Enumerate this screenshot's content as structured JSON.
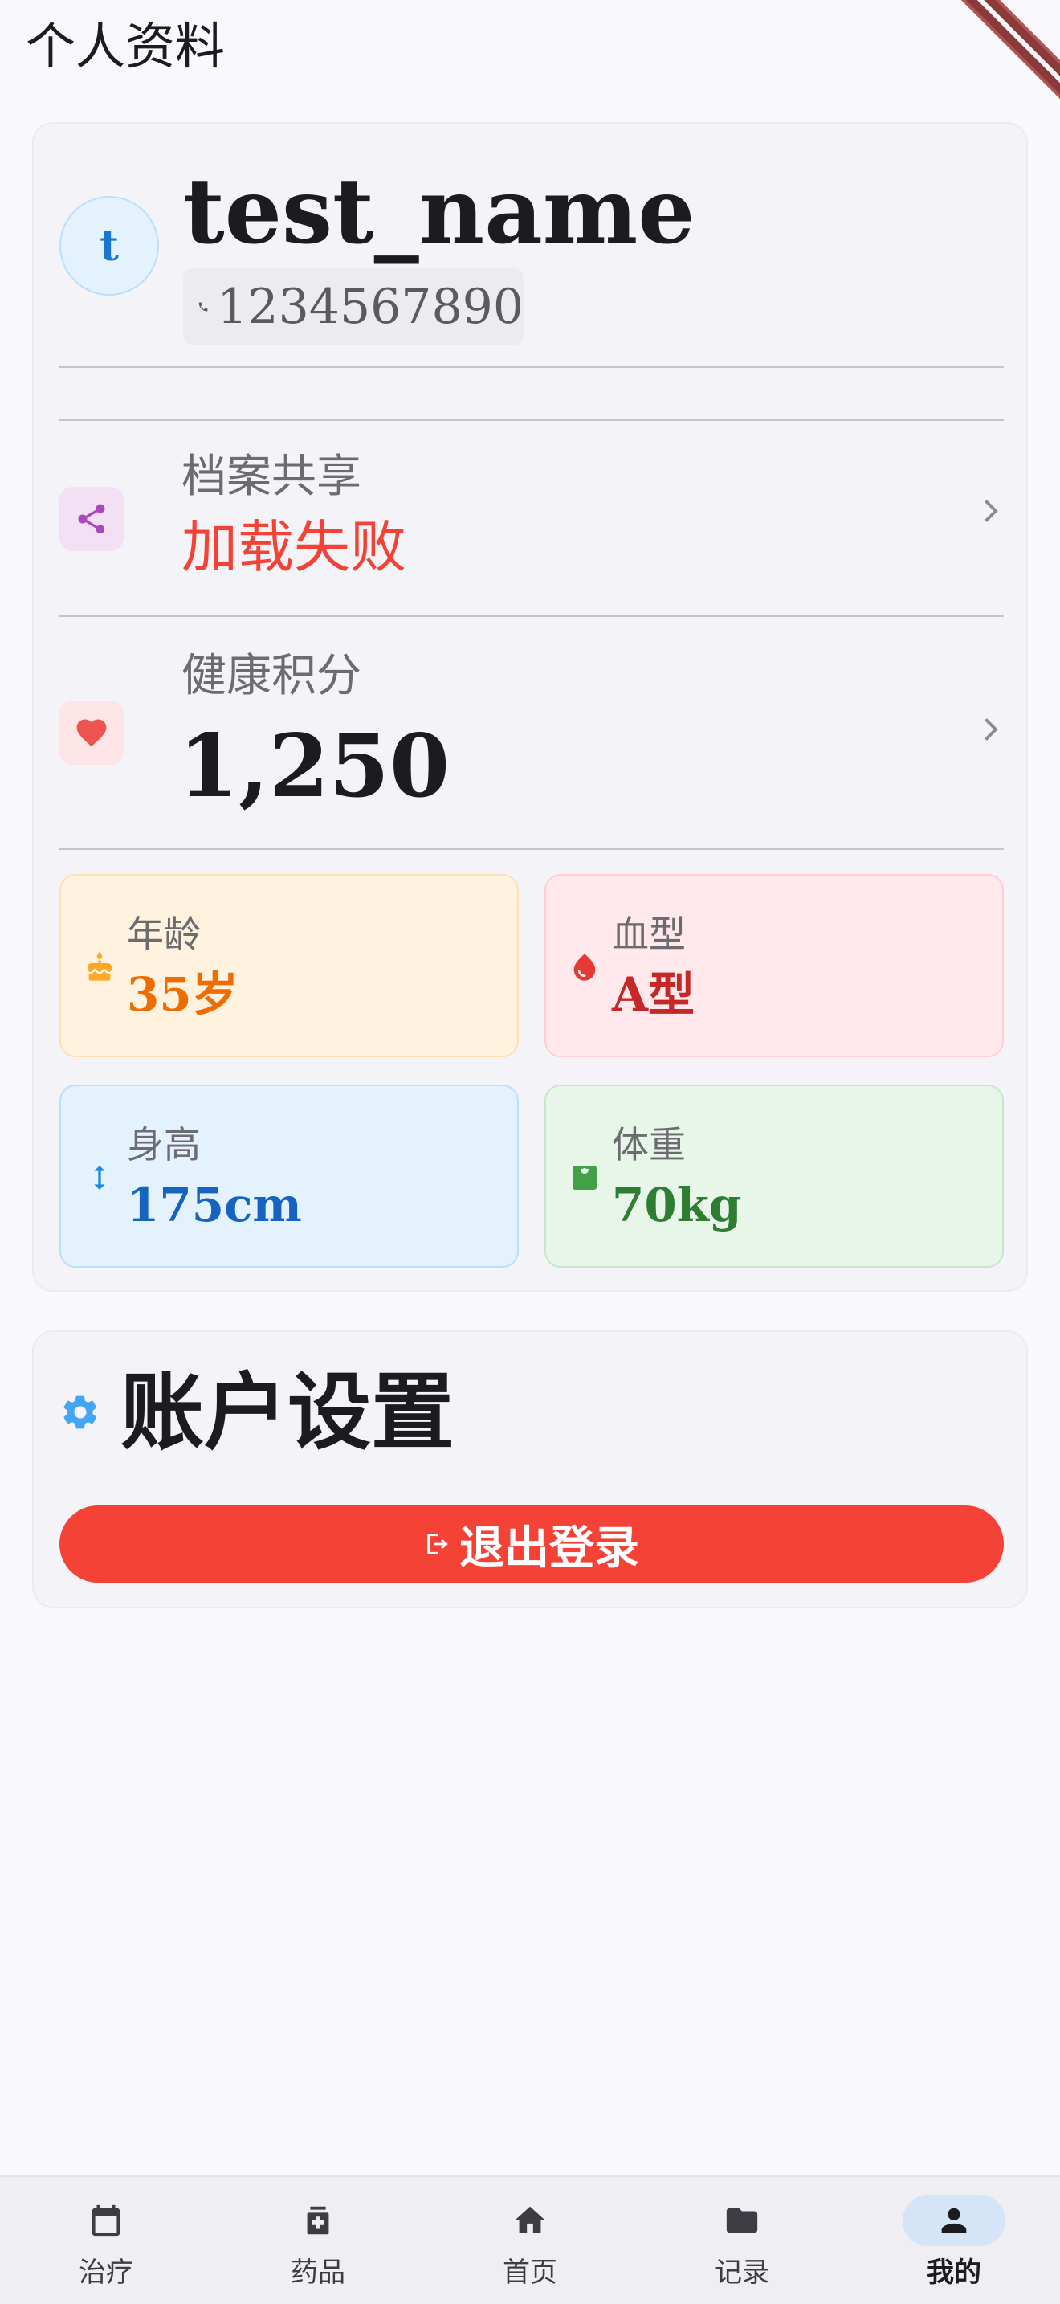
{
  "app_bar": {
    "title": "个人资料"
  },
  "profile": {
    "avatar_initial": "t",
    "username": "test_name",
    "phone": "1234567890"
  },
  "share": {
    "label": "档案共享",
    "value": "加载失败"
  },
  "points": {
    "label": "健康积分",
    "value": "1,250"
  },
  "stats": {
    "age": {
      "label": "年龄",
      "value": "35岁"
    },
    "blood": {
      "label": "血型",
      "value": "A型"
    },
    "height": {
      "label": "身高",
      "value": "175cm"
    },
    "weight": {
      "label": "体重",
      "value": "70kg"
    }
  },
  "settings": {
    "title": "账户设置",
    "logout_label": "退出登录"
  },
  "nav": {
    "items": [
      {
        "label": "治疗",
        "icon": "calendar-icon"
      },
      {
        "label": "药品",
        "icon": "medicine-icon"
      },
      {
        "label": "首页",
        "icon": "home-icon"
      },
      {
        "label": "记录",
        "icon": "folder-icon"
      },
      {
        "label": "我的",
        "icon": "person-icon"
      }
    ],
    "active_index": 4
  },
  "colors": {
    "error": "#f44336",
    "share_accent": "#ab47bc",
    "heart": "#ef5350",
    "age": "#ef6c00",
    "blood": "#c62828",
    "height": "#1565c0",
    "weight": "#2e7d32",
    "settings_gear": "#42a5f5"
  }
}
